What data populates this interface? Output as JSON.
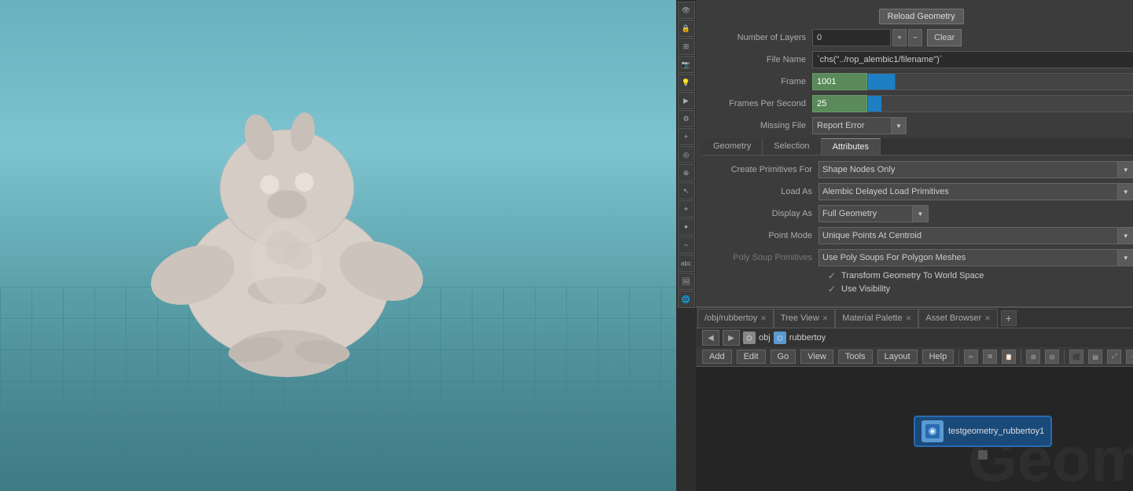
{
  "viewport": {
    "background": "#6ab0be"
  },
  "toolbar": {
    "buttons": [
      "eye",
      "lock",
      "grid",
      "camera",
      "light",
      "render",
      "settings",
      "plus",
      "snap",
      "magnet",
      "select",
      "lasso",
      "bone",
      "curve",
      "abc",
      "img",
      "world"
    ]
  },
  "properties": {
    "reload_button": "Reload Geometry",
    "number_of_layers_label": "Number of Layers",
    "number_of_layers_value": "0",
    "file_name_label": "File Name",
    "file_name_value": "`chs(\"../rop_alembic1/filename\")`",
    "frame_label": "Frame",
    "frame_value": "1001",
    "fps_label": "Frames Per Second",
    "fps_value": "25",
    "missing_file_label": "Missing File",
    "missing_file_value": "Report Error"
  },
  "tabs": {
    "geometry_label": "Geometry",
    "selection_label": "Selection",
    "attributes_label": "Attributes"
  },
  "attributes": {
    "create_primitives_label": "Create Primitives For",
    "create_primitives_value": "Shape Nodes Only",
    "load_as_label": "Load As",
    "load_as_value": "Alembic Delayed Load Primitives",
    "display_as_label": "Display As",
    "display_as_value": "Full Geometry",
    "point_mode_label": "Point Mode",
    "point_mode_value": "Unique Points At Centroid",
    "poly_soup_label": "Poly Soup Primitives",
    "poly_soup_value": "Use Poly Soups For Polygon Meshes",
    "transform_label": "Transform Geometry To World Space",
    "use_visibility_label": "Use Visibility"
  },
  "bottom_tabs": [
    {
      "label": "/obj/rubbertoy",
      "closable": true
    },
    {
      "label": "Tree View",
      "closable": true
    },
    {
      "label": "Material Palette",
      "closable": true
    },
    {
      "label": "Asset Browser",
      "closable": true
    }
  ],
  "bottom_toolbar": {
    "add_label": "Add",
    "edit_label": "Edit",
    "go_label": "Go",
    "view_label": "View",
    "tools_label": "Tools",
    "layout_label": "Layout",
    "help_label": "Help"
  },
  "breadcrumb": {
    "back_label": "◀",
    "forward_label": "▶",
    "obj_label": "obj",
    "node_label": "rubbertoy"
  },
  "node": {
    "label": "testgeometry_rubbertoy1"
  },
  "geom_bg": "Geom"
}
